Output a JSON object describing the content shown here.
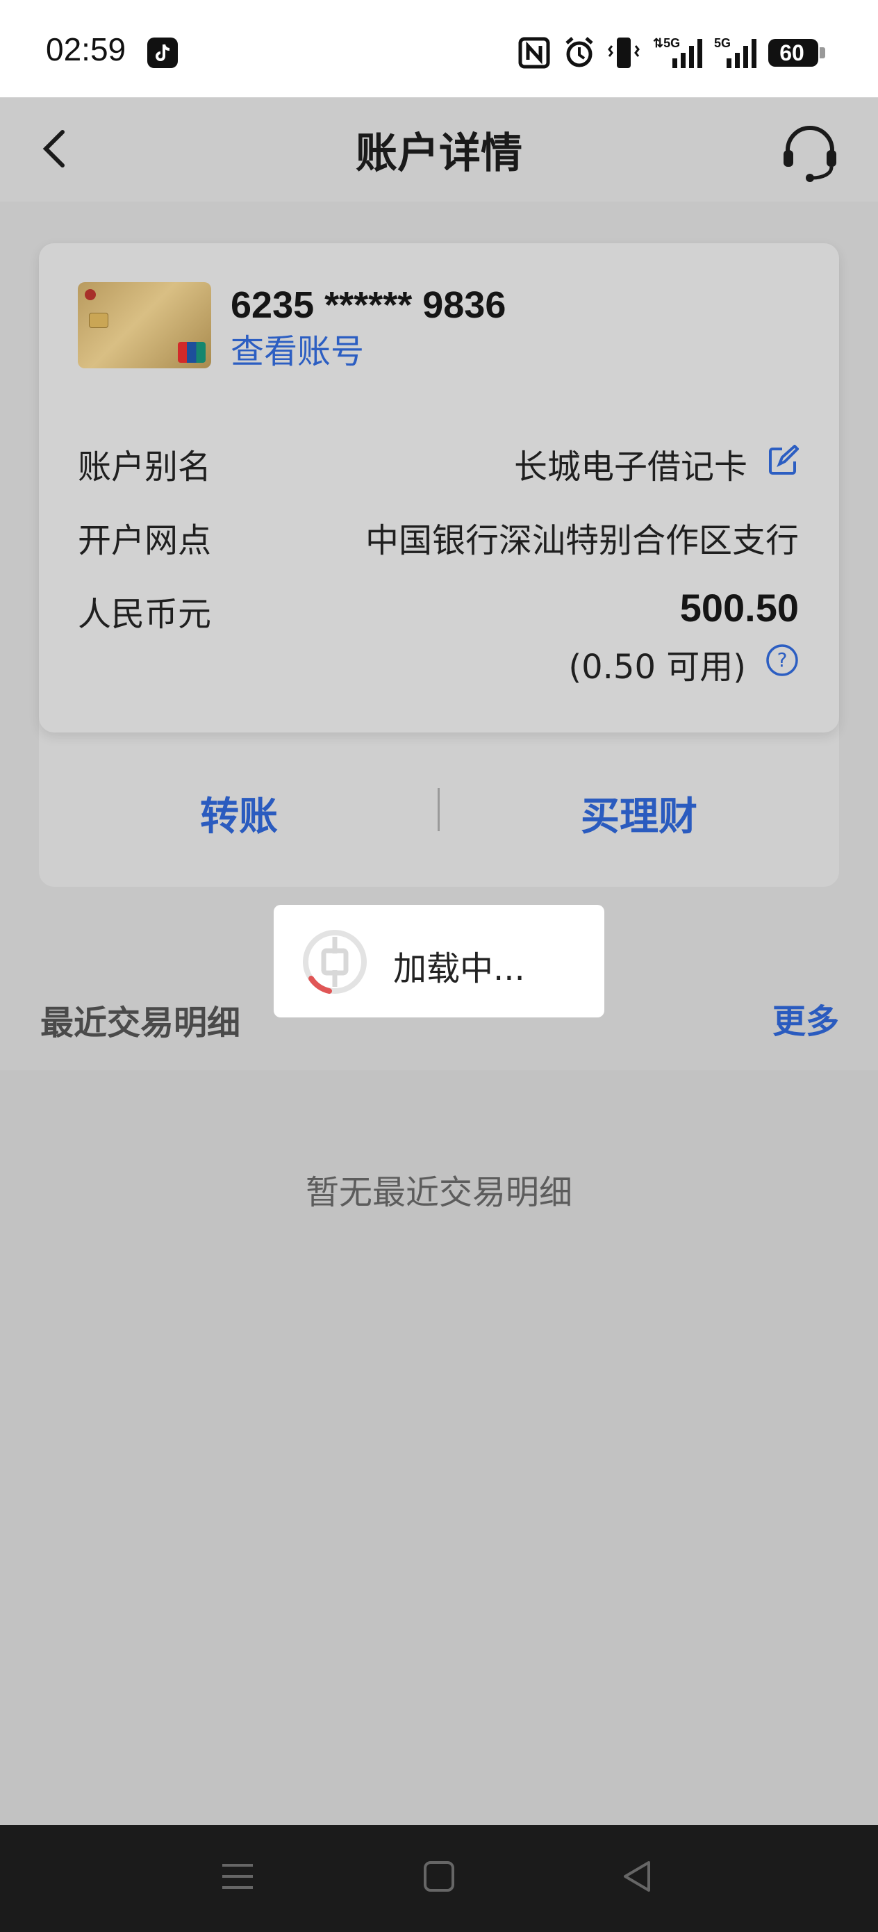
{
  "status_bar": {
    "time": "02:59",
    "battery": "60",
    "icons": [
      "tiktok-icon",
      "nfc-icon",
      "alarm-icon",
      "vibrate-icon",
      "signal-5g-icon",
      "signal-5g-icon"
    ]
  },
  "header": {
    "title": "账户详情",
    "back_icon": "chevron-left-icon",
    "service_icon": "headset-icon"
  },
  "account": {
    "card_number": "6235 ****** 9836",
    "view_account_link": "查看账号",
    "rows": [
      {
        "label": "账户别名",
        "value": "长城电子借记卡"
      },
      {
        "label": "开户网点",
        "value": "中国银行深汕特别合作区支行"
      },
      {
        "label": "人民币元",
        "value": "500.50"
      }
    ],
    "available": "(0.50 可用)"
  },
  "actions": {
    "transfer": "转账",
    "buy_finance": "买理财"
  },
  "toast": {
    "text": "加载中..."
  },
  "recent": {
    "title": "最近交易明细",
    "more": "更多",
    "empty": "暂无最近交易明细"
  },
  "colors": {
    "accent": "#2a5bbf",
    "overlay": "#c6c6c6",
    "spinner": "#e05555"
  }
}
